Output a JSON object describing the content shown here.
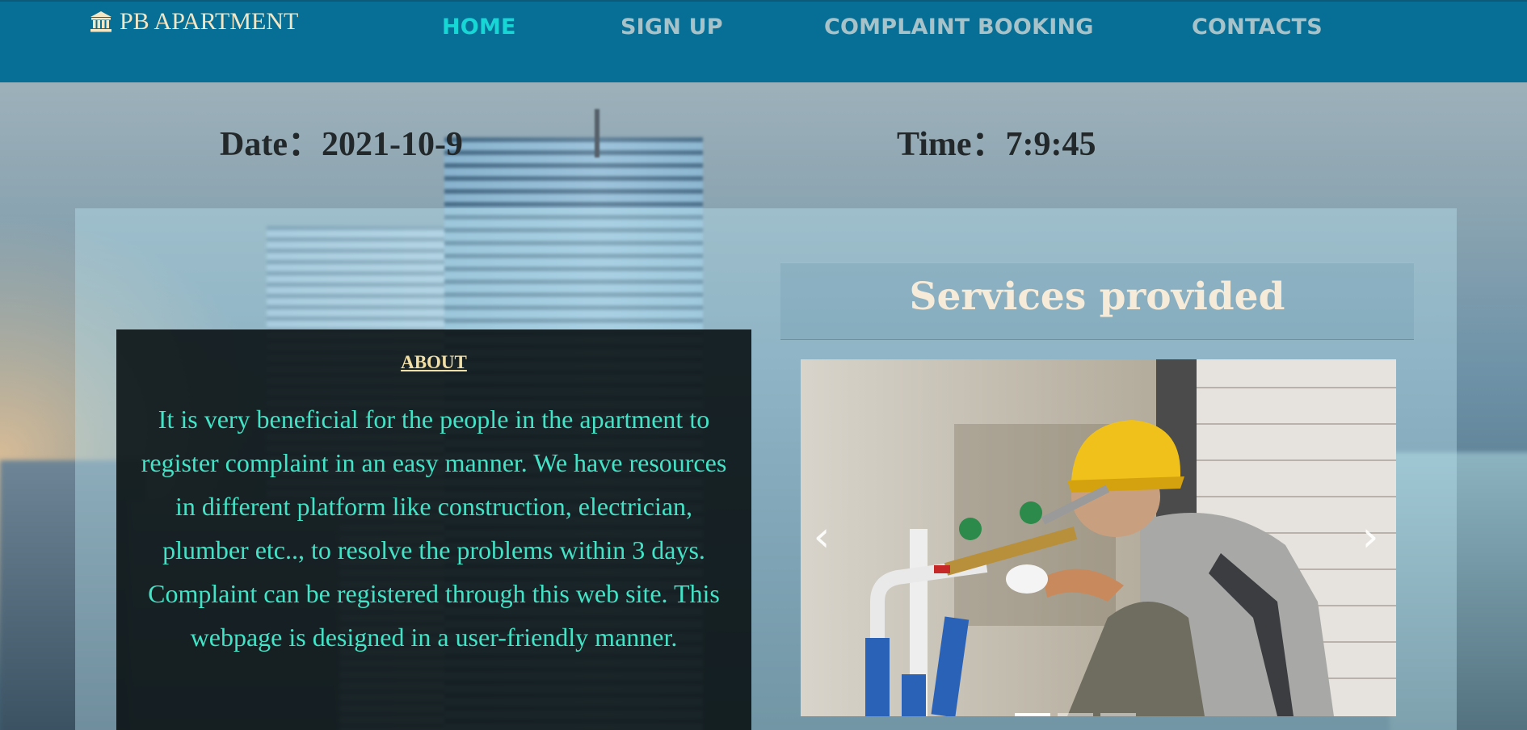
{
  "brand": {
    "name": "PB APARTMENT",
    "icon": "bank-icon",
    "color": "#f3e6c4"
  },
  "nav": {
    "items": [
      {
        "label": "HOME",
        "active": true
      },
      {
        "label": "SIGN UP",
        "active": false
      },
      {
        "label": "COMPLAINT BOOKING",
        "active": false
      },
      {
        "label": "CONTACTS",
        "active": false
      }
    ],
    "active_color": "#17d6d6",
    "inactive_color": "#a7c3c9",
    "bar_color": "#076f96"
  },
  "datetime": {
    "date_text": "Date：2021-10-9",
    "time_text": "Time：7:9:45"
  },
  "about": {
    "heading": "ABOUT",
    "body": "It is very beneficial for the people in the apartment to register complaint in an easy manner. We have resources in different platform like construction, electrician, plumber etc.., to resolve the problems within 3 days. Complaint can be registered through this web site. This webpage is designed in a user-friendly manner.",
    "text_color": "#42e3c6"
  },
  "services": {
    "heading": "Services provided",
    "carousel": {
      "slide_image": "plumber-photo",
      "prev_icon": "chevron-left-icon",
      "next_icon": "chevron-right-icon",
      "active_slide": 1,
      "slide_count": 3
    }
  }
}
